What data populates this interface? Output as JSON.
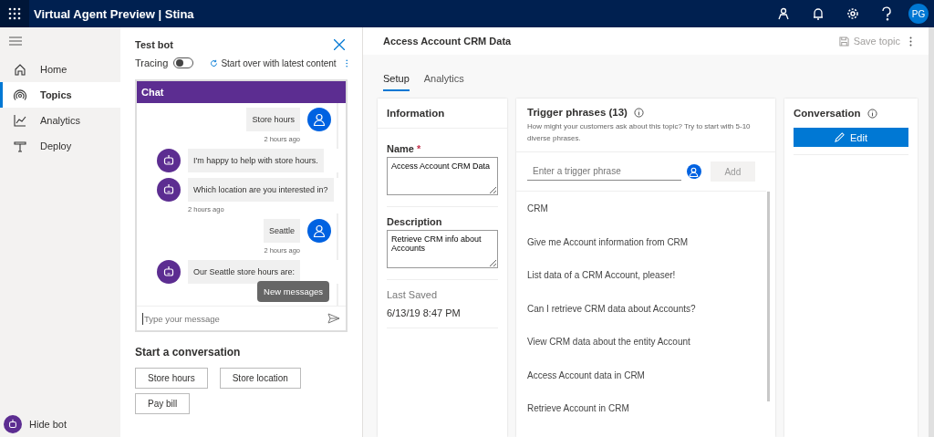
{
  "app_bar": {
    "title": "Virtual Agent Preview | Stina",
    "avatar": "PG"
  },
  "nav": {
    "items": [
      {
        "label": "Home",
        "selected": false
      },
      {
        "label": "Topics",
        "selected": true
      },
      {
        "label": "Analytics",
        "selected": false
      },
      {
        "label": "Deploy",
        "selected": false
      }
    ],
    "hide_bot": "Hide bot"
  },
  "test_bot": {
    "title": "Test bot",
    "tracing": {
      "label": "Tracing",
      "on": false
    },
    "start_over": "Start over with latest content",
    "chat": {
      "title": "Chat",
      "messages": [
        {
          "kind": "user",
          "text": "Store hours",
          "time": "2 hours ago"
        },
        {
          "kind": "bot",
          "text": "I'm happy to help with store hours."
        },
        {
          "kind": "bot",
          "text": "Which location are you interested in?",
          "time": "2 hours ago"
        },
        {
          "kind": "user",
          "text": "Seattle",
          "time": "2 hours ago"
        },
        {
          "kind": "bot",
          "text": "Our Seattle store hours are:"
        }
      ],
      "new_messages": "New messages",
      "placeholder": "Type your message"
    },
    "start_title": "Start a conversation",
    "suggestions": [
      "Store hours",
      "Store location",
      "Pay bill"
    ]
  },
  "topic": {
    "title": "Access Account CRM Data",
    "save": {
      "label": "Save topic",
      "disabled": true
    },
    "tabs": [
      {
        "label": "Setup",
        "selected": true
      },
      {
        "label": "Analytics",
        "selected": false
      }
    ],
    "information": {
      "title": "Information",
      "name_label": "Name",
      "required_mark": "*",
      "name_value": "Access Account CRM Data",
      "description_label": "Description",
      "description_value": "Retrieve CRM info about Accounts",
      "last_saved_label": "Last Saved",
      "last_saved": "6/13/19 8:47 PM"
    },
    "triggers": {
      "title": "Trigger phrases (13)",
      "hint": "How might your customers ask about this topic? Try to start with 5-10 diverse phrases.",
      "placeholder": "Enter a trigger phrase",
      "add": "Add",
      "phrases": [
        "CRM",
        "Give me Account information from CRM",
        "List data of a CRM Account, pleaser!",
        "Can I retrieve CRM data about Accounts?",
        "View CRM data about the entity Account",
        "Access Account data in CRM",
        "Retrieve Account in CRM"
      ]
    },
    "conversation": {
      "title": "Conversation",
      "edit": "Edit"
    }
  }
}
